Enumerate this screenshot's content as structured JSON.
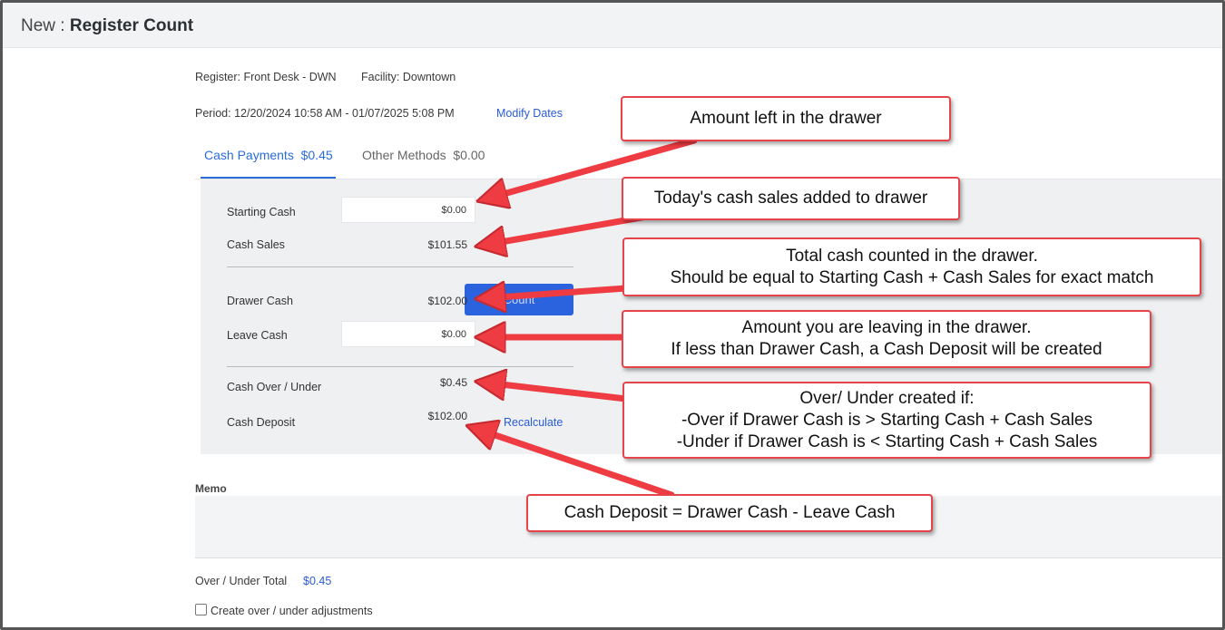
{
  "page": {
    "prefix": "New :",
    "title": "Register Count"
  },
  "info": {
    "register": "Register: Front Desk - DWN",
    "facility": "Facility: Downtown",
    "period": "Period: 12/20/2024 10:58 AM - 01/07/2025 5:08 PM",
    "modify_dates": "Modify Dates"
  },
  "tabs": [
    {
      "label": "Cash Payments",
      "amount": "$0.45",
      "active": true
    },
    {
      "label": "Other Methods",
      "amount": "$0.00",
      "active": false
    }
  ],
  "cash": {
    "starting_cash_label": "Starting Cash",
    "starting_cash_value": "$0.00",
    "cash_sales_label": "Cash Sales",
    "cash_sales_value": "$101.55",
    "drawer_cash_label": "Drawer Cash",
    "drawer_cash_value": "$102.00",
    "count_button": "Count",
    "leave_cash_label": "Leave Cash",
    "leave_cash_value": "$0.00",
    "over_under_label": "Cash Over / Under",
    "over_under_value": "$0.45",
    "cash_deposit_label": "Cash Deposit",
    "cash_deposit_value": "$102.00",
    "recalculate": "Recalculate"
  },
  "memo": {
    "label": "Memo",
    "value": ""
  },
  "footer": {
    "over_under_total_label": "Over / Under Total",
    "over_under_total_value": "$0.45",
    "create_adjustments_label": "Create over / under adjustments",
    "create_adjustments_checked": false
  },
  "callouts": {
    "amount_left": "Amount left in the drawer",
    "cash_sales": "Today's cash sales added to drawer",
    "total_counted_1": "Total cash counted in the drawer.",
    "total_counted_2": "Should be equal to Starting Cash + Cash Sales for exact match",
    "leaving_1": "Amount you are leaving in the drawer.",
    "leaving_2": "If less than Drawer Cash, a Cash Deposit will be created",
    "over_under_1": "Over/ Under created if:",
    "over_under_2": "-Over if Drawer Cash is > Starting Cash + Cash Sales",
    "over_under_3": "-Under if Drawer Cash is < Starting Cash + Cash Sales",
    "deposit": "Cash Deposit = Drawer Cash - Leave Cash"
  },
  "colors": {
    "accent": "#2a6cd8",
    "callout_border": "#e5444a",
    "arrow": "#ef3b42",
    "panel": "#eef0f2"
  }
}
